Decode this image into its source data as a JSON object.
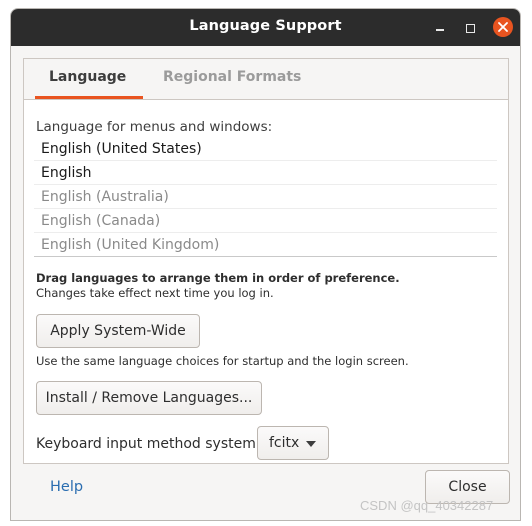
{
  "window": {
    "title": "Language Support"
  },
  "tabs": [
    {
      "label": "Language",
      "active": true
    },
    {
      "label": "Regional Formats",
      "active": false
    }
  ],
  "language_panel": {
    "section_label": "Language for menus and windows:",
    "languages": [
      {
        "label": "English (United States)",
        "enabled": true
      },
      {
        "label": "English",
        "enabled": true
      },
      {
        "label": "English (Australia)",
        "enabled": false
      },
      {
        "label": "English (Canada)",
        "enabled": false
      },
      {
        "label": "English (United Kingdom)",
        "enabled": false
      }
    ],
    "drag_hint": "Drag languages to arrange them in order of preference.",
    "changes_hint": "Changes take effect next time you log in.",
    "apply_button": "Apply System-Wide",
    "apply_description": "Use the same language choices for startup and the login screen.",
    "install_button": "Install / Remove Languages...",
    "keyboard_label": "Keyboard input method system:",
    "keyboard_value": "fcitx"
  },
  "footer": {
    "help_link": "Help",
    "close_button": "Close"
  },
  "watermark": "CSDN @qq_40342287",
  "colors": {
    "accent": "#e95420",
    "titlebar": "#2c2c2c",
    "link": "#2a6db0"
  }
}
